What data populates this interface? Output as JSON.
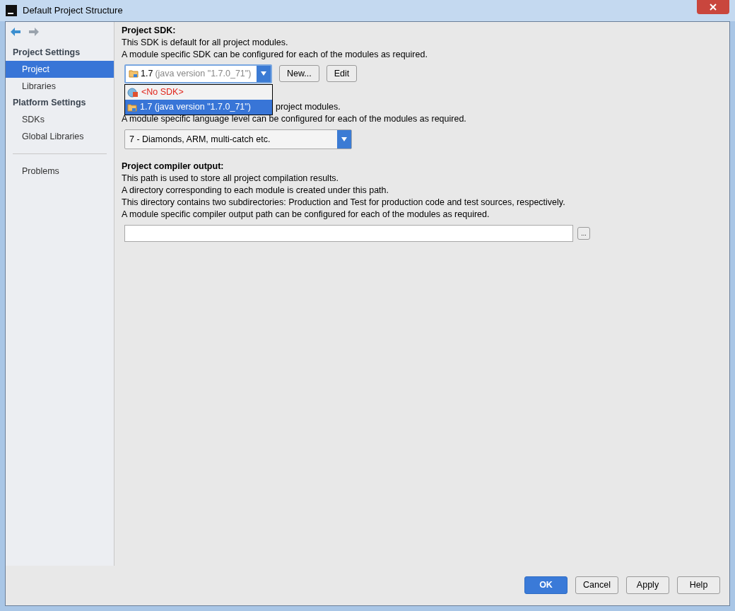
{
  "window": {
    "title": "Default Project Structure"
  },
  "sidebar": {
    "sections": [
      {
        "title": "Project Settings",
        "items": [
          {
            "label": "Project",
            "selected": true
          },
          {
            "label": "Libraries",
            "selected": false
          }
        ]
      },
      {
        "title": "Platform Settings",
        "items": [
          {
            "label": "SDKs",
            "selected": false
          },
          {
            "label": "Global Libraries",
            "selected": false
          }
        ]
      }
    ],
    "bottom_items": [
      {
        "label": "Problems",
        "selected": false
      }
    ]
  },
  "project_sdk": {
    "heading": "Project SDK:",
    "lines": [
      "This SDK is default for all project modules.",
      "A module specific SDK can be configured for each of the modules as required."
    ],
    "select": {
      "version": "1.7",
      "detail": "(java version \"1.7.0_71\")"
    },
    "new_button": "New...",
    "edit_button": "Edit",
    "dropdown": [
      {
        "kind": "none",
        "label": "<No SDK>",
        "selected": false
      },
      {
        "kind": "jdk",
        "label": "1.7 (java version \"1.7.0_71\")",
        "selected": true
      }
    ]
  },
  "language_level": {
    "line_fragment": "project modules.",
    "lines": [
      "A module specific language level can be configured for each of the modules as required."
    ],
    "select": "7 - Diamonds, ARM, multi-catch etc."
  },
  "compiler_output": {
    "heading": "Project compiler output:",
    "lines": [
      "This path is used to store all project compilation results.",
      "A directory corresponding to each module is created under this path.",
      "This directory contains two subdirectories: Production and Test for production code and test sources, respectively.",
      "A module specific compiler output path can be configured for each of the modules as required."
    ],
    "browse_button": "..."
  },
  "buttons": [
    {
      "label": "OK",
      "kind": "primary"
    },
    {
      "label": "Cancel",
      "kind": "normal"
    },
    {
      "label": "Apply",
      "kind": "normal"
    },
    {
      "label": "Help",
      "kind": "normal"
    }
  ]
}
